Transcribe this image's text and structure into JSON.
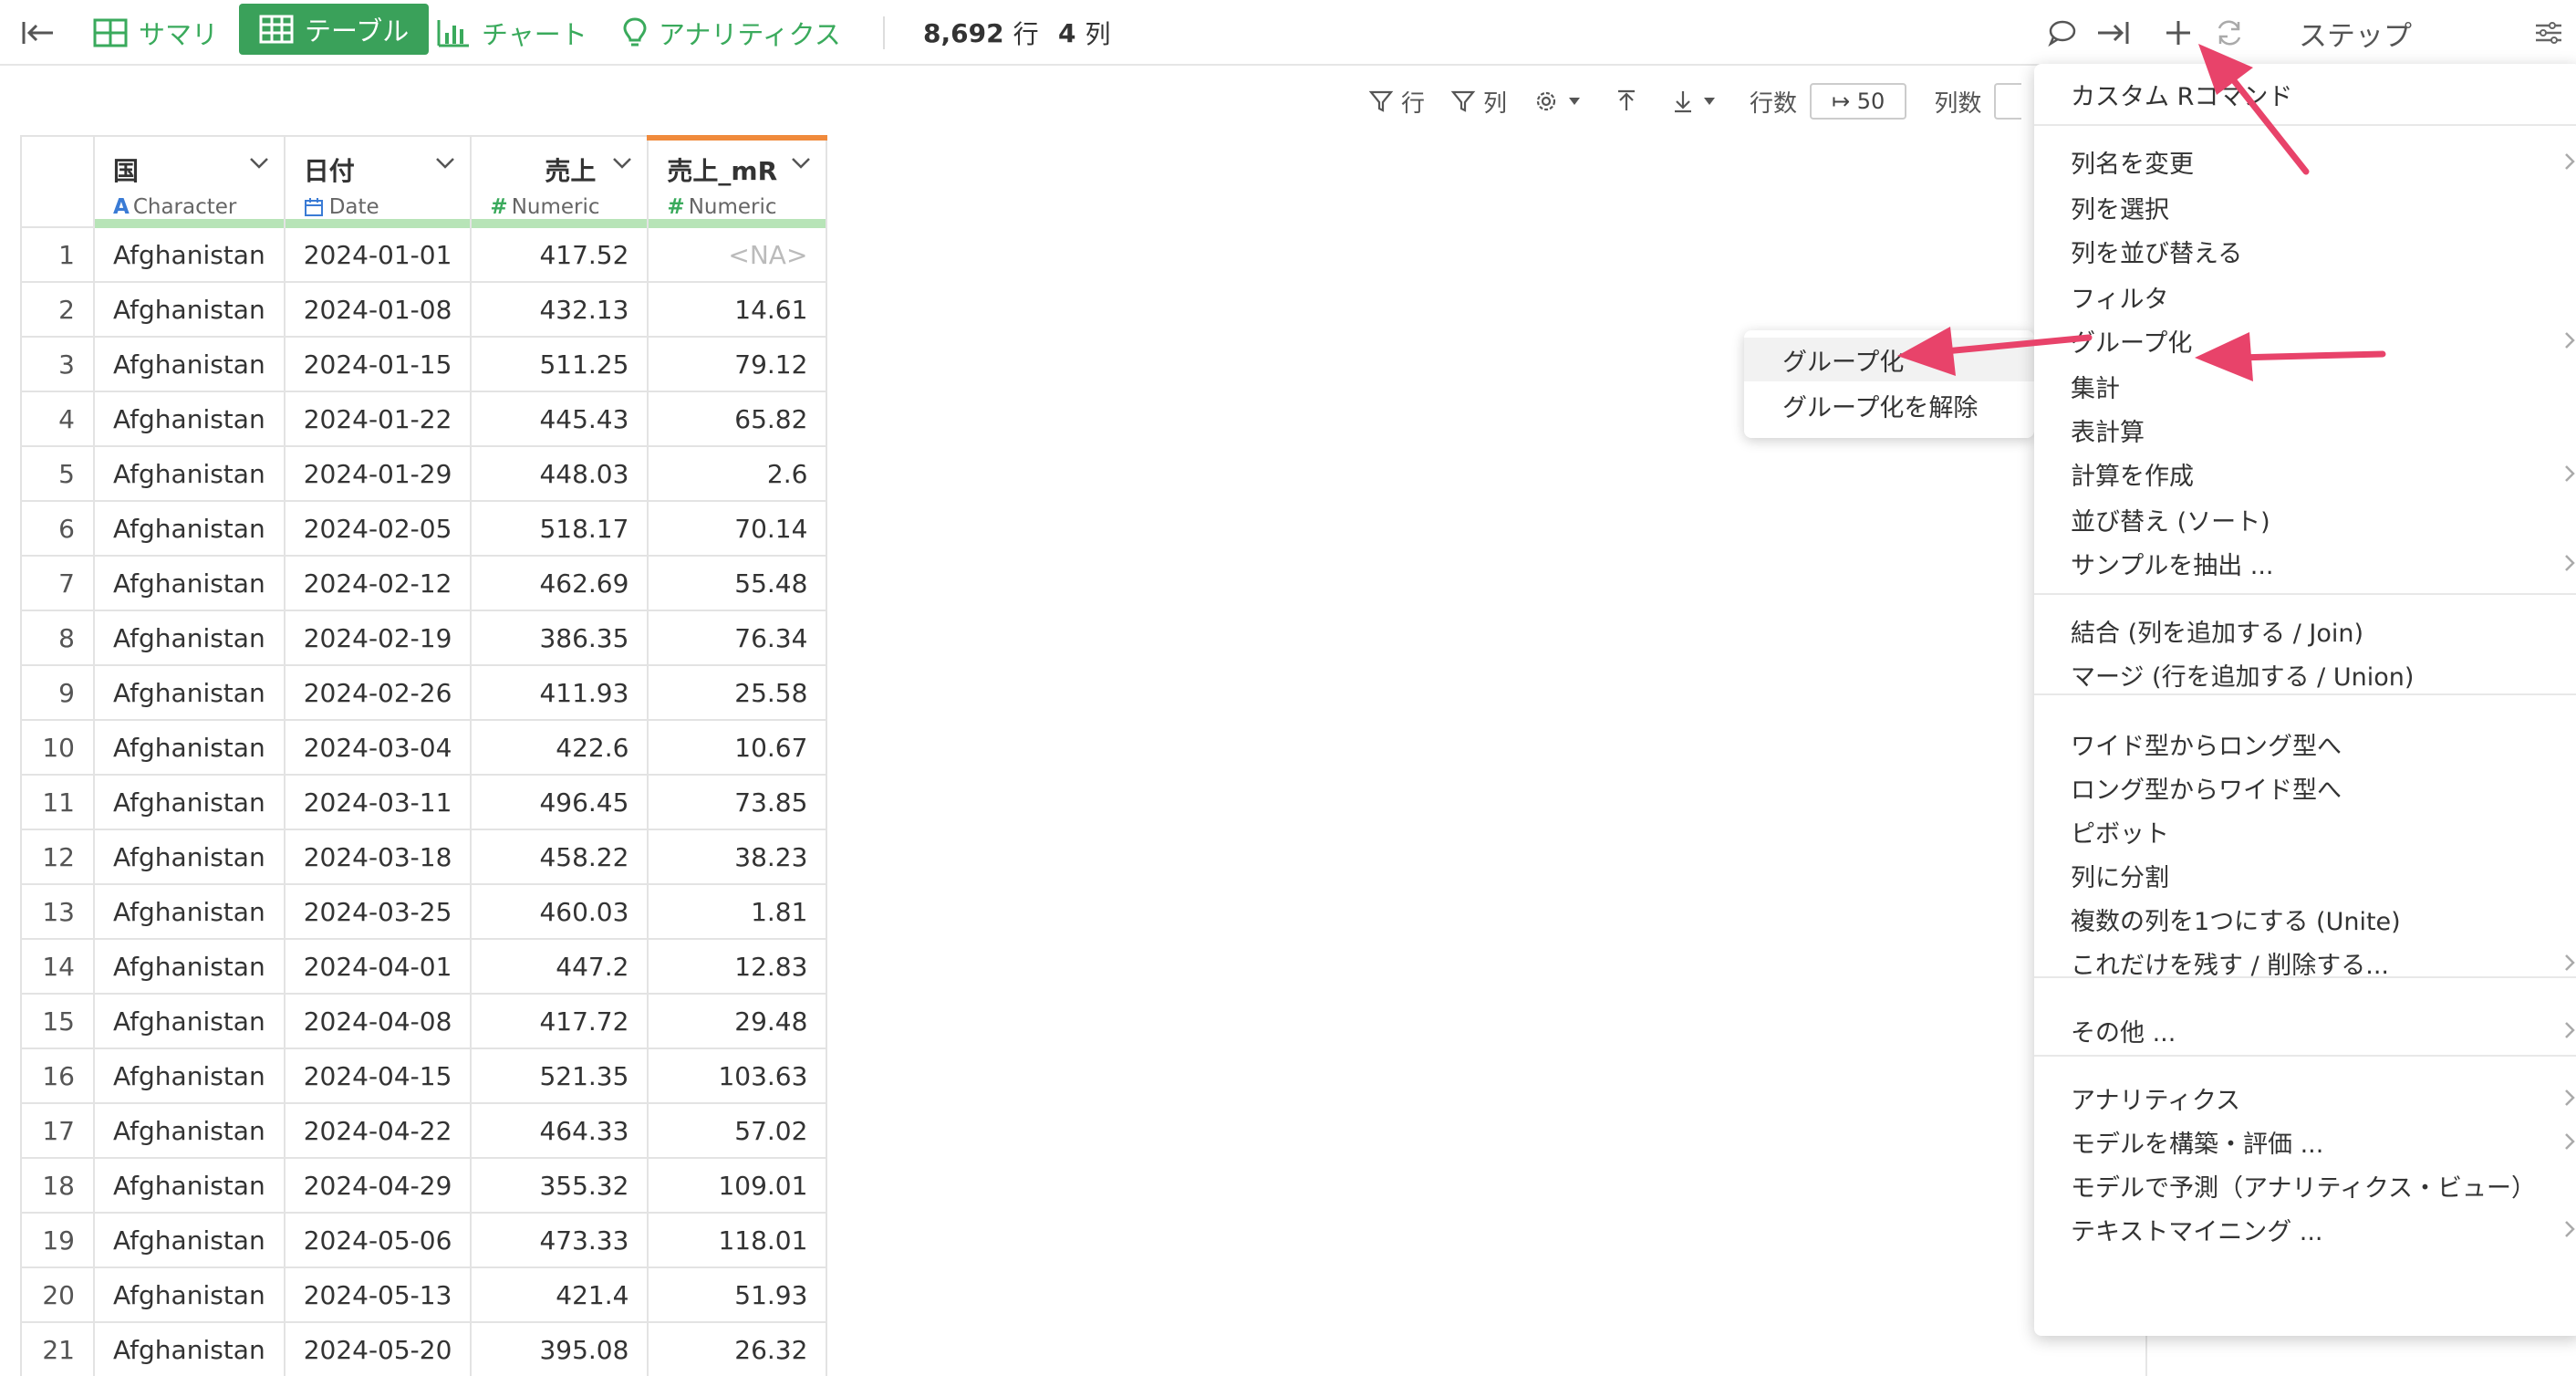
{
  "topbar": {
    "tabs": [
      {
        "label": "サマリ",
        "icon": "summary-grid-icon"
      },
      {
        "label": "テーブル",
        "icon": "table-icon"
      },
      {
        "label": "チャート",
        "icon": "bar-chart-icon"
      },
      {
        "label": "アナリティクス",
        "icon": "lightbulb-icon"
      }
    ],
    "row_count": "8,692",
    "row_unit": "行",
    "col_count": "4",
    "col_unit": "列",
    "step_title": "ステップ"
  },
  "toolbar": {
    "filter_row": "行",
    "filter_col": "列",
    "rows_label": "行数",
    "rows_value": "↦ 50",
    "cols_label": "列数"
  },
  "table": {
    "columns": [
      {
        "name": "国",
        "type": "Character",
        "type_glyph": "A"
      },
      {
        "name": "日付",
        "type": "Date",
        "type_glyph": "calendar"
      },
      {
        "name": "売上",
        "type": "Numeric",
        "type_glyph": "#"
      },
      {
        "name": "売上_mR",
        "type": "Numeric",
        "type_glyph": "#"
      }
    ],
    "rows": [
      [
        "1",
        "Afghanistan",
        "2024-01-01",
        "417.52",
        "<NA>"
      ],
      [
        "2",
        "Afghanistan",
        "2024-01-08",
        "432.13",
        "14.61"
      ],
      [
        "3",
        "Afghanistan",
        "2024-01-15",
        "511.25",
        "79.12"
      ],
      [
        "4",
        "Afghanistan",
        "2024-01-22",
        "445.43",
        "65.82"
      ],
      [
        "5",
        "Afghanistan",
        "2024-01-29",
        "448.03",
        "2.6"
      ],
      [
        "6",
        "Afghanistan",
        "2024-02-05",
        "518.17",
        "70.14"
      ],
      [
        "7",
        "Afghanistan",
        "2024-02-12",
        "462.69",
        "55.48"
      ],
      [
        "8",
        "Afghanistan",
        "2024-02-19",
        "386.35",
        "76.34"
      ],
      [
        "9",
        "Afghanistan",
        "2024-02-26",
        "411.93",
        "25.58"
      ],
      [
        "10",
        "Afghanistan",
        "2024-03-04",
        "422.6",
        "10.67"
      ],
      [
        "11",
        "Afghanistan",
        "2024-03-11",
        "496.45",
        "73.85"
      ],
      [
        "12",
        "Afghanistan",
        "2024-03-18",
        "458.22",
        "38.23"
      ],
      [
        "13",
        "Afghanistan",
        "2024-03-25",
        "460.03",
        "1.81"
      ],
      [
        "14",
        "Afghanistan",
        "2024-04-01",
        "447.2",
        "12.83"
      ],
      [
        "15",
        "Afghanistan",
        "2024-04-08",
        "417.72",
        "29.48"
      ],
      [
        "16",
        "Afghanistan",
        "2024-04-15",
        "521.35",
        "103.63"
      ],
      [
        "17",
        "Afghanistan",
        "2024-04-22",
        "464.33",
        "57.02"
      ],
      [
        "18",
        "Afghanistan",
        "2024-04-29",
        "355.32",
        "109.01"
      ],
      [
        "19",
        "Afghanistan",
        "2024-05-06",
        "473.33",
        "118.01"
      ],
      [
        "20",
        "Afghanistan",
        "2024-05-13",
        "421.4",
        "51.93"
      ],
      [
        "21",
        "Afghanistan",
        "2024-05-20",
        "395.08",
        "26.32"
      ]
    ]
  },
  "menu": {
    "items": [
      {
        "label": "カスタム Rコマンド",
        "submenu": false
      },
      {
        "label": "列名を変更",
        "submenu": true
      },
      {
        "label": "列を選択",
        "submenu": false
      },
      {
        "label": "列を並び替える",
        "submenu": false
      },
      {
        "label": "フィルタ",
        "submenu": false
      },
      {
        "label": "グループ化",
        "submenu": true
      },
      {
        "label": "集計",
        "submenu": false
      },
      {
        "label": "表計算",
        "submenu": false
      },
      {
        "label": "計算を作成",
        "submenu": true
      },
      {
        "label": "並び替え (ソート)",
        "submenu": false
      },
      {
        "label": "サンプルを抽出 ...",
        "submenu": true
      },
      {
        "label": "結合 (列を追加する / Join)",
        "submenu": false
      },
      {
        "label": "マージ (行を追加する / Union)",
        "submenu": false
      },
      {
        "label": "ワイド型からロング型へ",
        "submenu": false
      },
      {
        "label": "ロング型からワイド型へ",
        "submenu": false
      },
      {
        "label": "ピボット",
        "submenu": false
      },
      {
        "label": "列に分割",
        "submenu": false
      },
      {
        "label": "複数の列を1つにする (Unite)",
        "submenu": false
      },
      {
        "label": "これだけを残す / 削除する...",
        "submenu": true
      },
      {
        "label": "その他 ...",
        "submenu": true
      },
      {
        "label": "アナリティクス",
        "submenu": true
      },
      {
        "label": "モデルを構築・評価 ...",
        "submenu": true
      },
      {
        "label": "モデルで予測（アナリティクス・ビュー）",
        "submenu": false
      },
      {
        "label": "テキストマイニング ...",
        "submenu": true
      }
    ]
  },
  "submenu": {
    "items": [
      {
        "label": "グループ化"
      },
      {
        "label": "グループ化を解除"
      }
    ]
  },
  "colors": {
    "accent_green": "#3aa15a",
    "arrow_pink": "#e8436a",
    "highlight_orange": "#f08a3c"
  }
}
